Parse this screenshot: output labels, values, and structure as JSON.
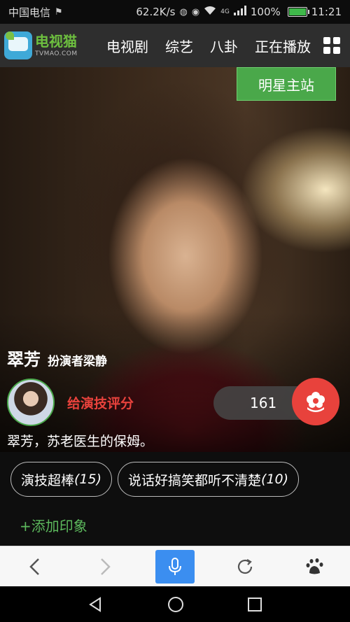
{
  "status_bar": {
    "carrier": "中国电信",
    "net_speed": "62.2K/s",
    "network_type": "4G",
    "battery": "100%",
    "battery_level": 1.0,
    "time": "11:21"
  },
  "app_header": {
    "logo_cn": "电视猫",
    "logo_en": "TVMAO.COM",
    "nav": [
      "电视剧",
      "综艺",
      "八卦",
      "正在播放"
    ]
  },
  "hero": {
    "star_home_button": "明星主站",
    "character_name": "翠芳",
    "actor_line": "扮演者梁静",
    "rate_link": "给演技评分",
    "vote_count": "161",
    "description": "翠芳，苏老医生的保姆。"
  },
  "impressions": {
    "tags": [
      {
        "label": "演技超棒",
        "count": "(15)"
      },
      {
        "label": "说话好搞笑都听不清楚",
        "count": "(10)"
      }
    ],
    "add_label": "+添加印象"
  },
  "colors": {
    "brand_green": "#4aa84a",
    "accent_red": "#e8423c",
    "mic_blue": "#3b8ef0"
  },
  "icons": {
    "browser_bar": [
      "back-arrow-icon",
      "forward-arrow-icon",
      "microphone-icon",
      "refresh-icon",
      "baidu-paw-icon"
    ],
    "system_nav": [
      "back-triangle-icon",
      "home-circle-icon",
      "recents-square-icon"
    ]
  }
}
